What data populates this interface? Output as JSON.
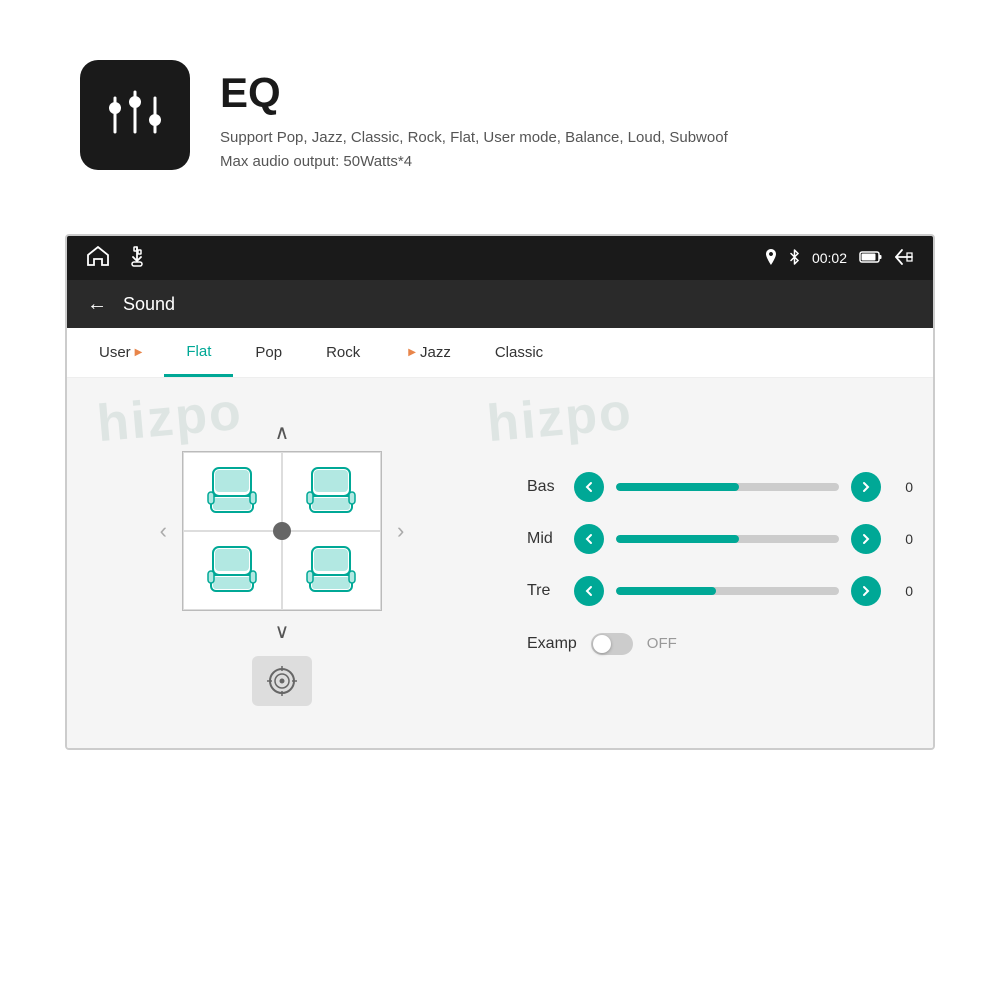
{
  "header": {
    "eq_title": "EQ",
    "eq_desc_line1": "Support Pop, Jazz, Classic, Rock, Flat, User mode, Balance, Loud, Subwoof",
    "eq_desc_line2": "Max audio output: 50Watts*4"
  },
  "status_bar": {
    "time": "00:02"
  },
  "nav_bar": {
    "back_label": "←",
    "title": "Sound"
  },
  "tabs": [
    {
      "label": "User",
      "active": false,
      "arrow": true
    },
    {
      "label": "Flat",
      "active": true,
      "arrow": false
    },
    {
      "label": "Pop",
      "active": false,
      "arrow": false
    },
    {
      "label": "Rock",
      "active": false,
      "arrow": false
    },
    {
      "label": "Jazz",
      "active": false,
      "arrow": true
    },
    {
      "label": "Classic",
      "active": false,
      "arrow": false
    }
  ],
  "watermarks": [
    "hizpo",
    "hizpo"
  ],
  "eq_controls": {
    "bas": {
      "label": "Bas",
      "value": "0",
      "fill_pct": 55
    },
    "mid": {
      "label": "Mid",
      "value": "0",
      "fill_pct": 55
    },
    "tre": {
      "label": "Tre",
      "value": "0",
      "fill_pct": 45
    }
  },
  "examp": {
    "label": "Examp",
    "state": "OFF"
  },
  "chevron_up": "∧",
  "chevron_down": "∨",
  "left_arrow": "‹",
  "right_arrow": "›"
}
